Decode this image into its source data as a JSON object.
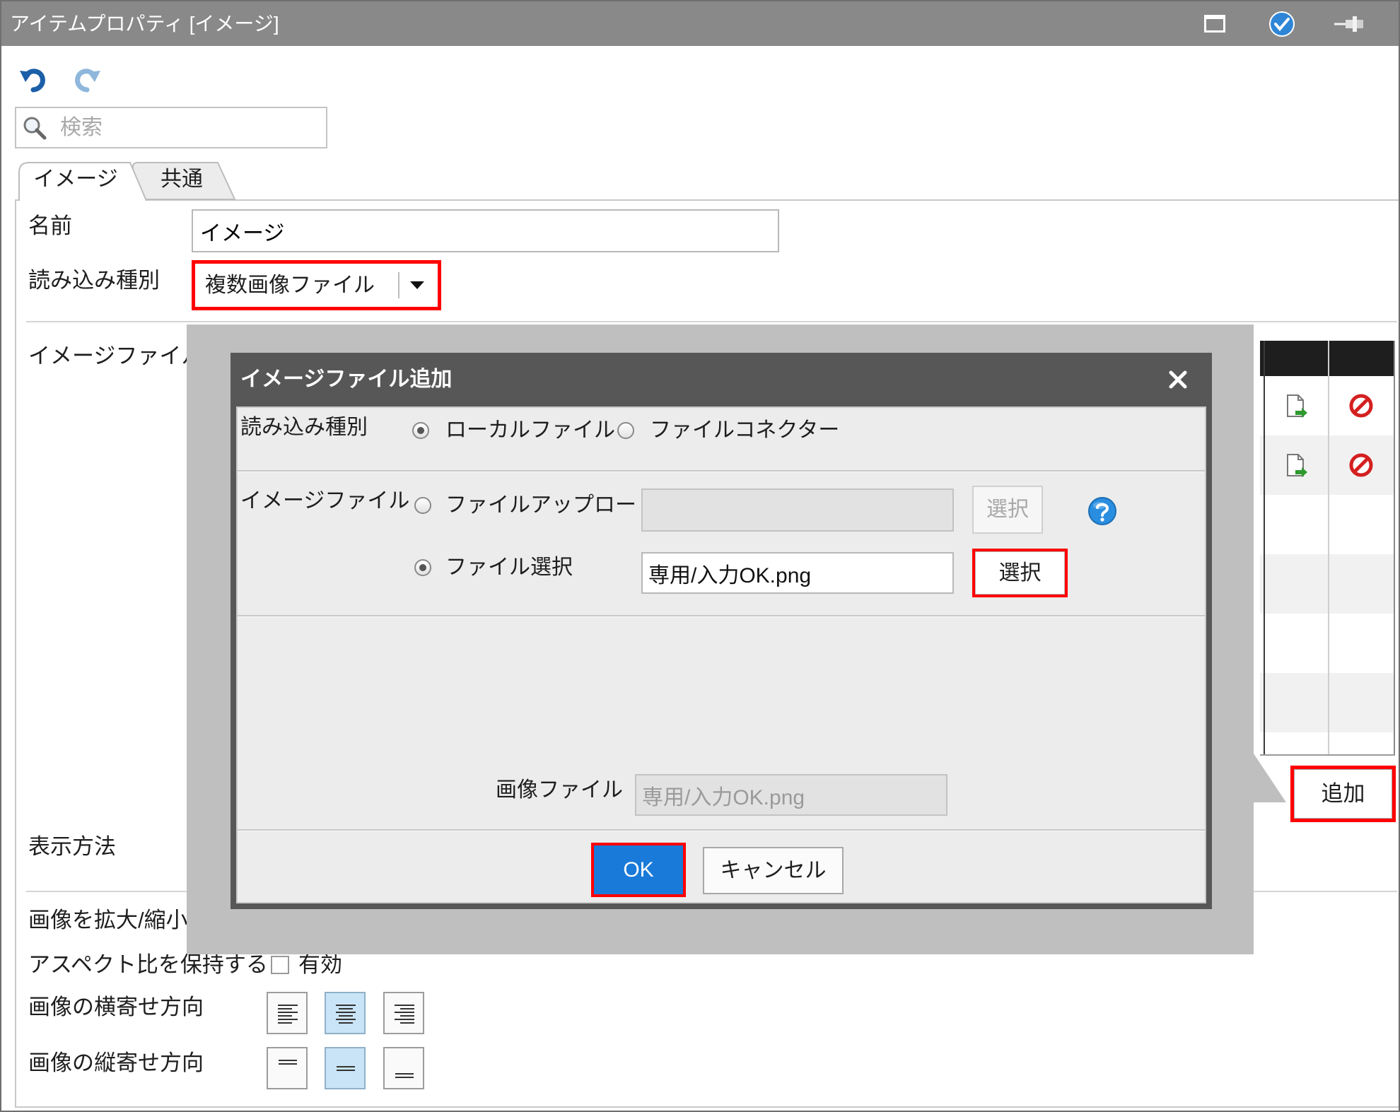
{
  "window": {
    "title": "アイテムプロパティ [イメージ]",
    "icons": [
      "maximize-icon",
      "check-icon",
      "pin-icon"
    ]
  },
  "toolbar": {
    "icons": [
      "undo-icon",
      "redo-icon"
    ]
  },
  "search": {
    "placeholder": "検索",
    "icon": "search-icon"
  },
  "tabs": [
    {
      "label": "イメージ",
      "active": true
    },
    {
      "label": "共通",
      "active": false
    }
  ],
  "form": {
    "name_label": "名前",
    "name_value": "イメージ",
    "load_type_label": "読み込み種別",
    "load_type_value": "複数画像ファイル",
    "image_file_label": "イメージファイル",
    "display_method_label": "表示方法",
    "scale_label": "画像を拡大/縮小",
    "aspect_label": "アスペクト比を保持する",
    "aspect_checkbox_label": "有効",
    "aspect_checked": false,
    "h_align_label": "画像の横寄せ方向",
    "h_align": {
      "options": [
        "align-left-icon",
        "align-center-icon",
        "align-right-icon"
      ],
      "selected": "align-center-icon"
    },
    "v_align_label": "画像の縦寄せ方向",
    "v_align": {
      "options": [
        "align-top-icon",
        "align-middle-icon",
        "align-bottom-icon"
      ],
      "selected": "align-middle-icon"
    }
  },
  "file_list": {
    "rows": [
      {
        "edit_icon": "file-edit-icon",
        "delete_icon": "delete-icon"
      },
      {
        "edit_icon": "file-edit-icon",
        "delete_icon": "delete-icon"
      }
    ],
    "add_button": "追加"
  },
  "dialog": {
    "title": "イメージファイル追加",
    "close_icon": "close-icon",
    "load_type_label": "読み込み種別",
    "load_type_options": [
      {
        "label": "ローカルファイル",
        "checked": true
      },
      {
        "label": "ファイルコネクター",
        "checked": false
      }
    ],
    "image_file_label": "イメージファイル",
    "upload_option": {
      "label": "ファイルアップロード",
      "checked": false
    },
    "upload_button": "選択",
    "help_icon": "help-icon",
    "select_option": {
      "label": "ファイル選択",
      "checked": true
    },
    "select_input_value": "専用/入力OK.png",
    "select_button": "選択",
    "image_file_field_label": "画像ファイル",
    "image_file_field_value": "専用/入力OK.png",
    "ok_button": "OK",
    "cancel_button": "キャンセル"
  },
  "colors": {
    "title_bar": "#898989",
    "highlight": "#ff0000",
    "primary_button": "#1a7ad9",
    "selected_align": "#c9e4f6",
    "dialog_frame": "#575757",
    "backdrop": "#bfbfbf"
  }
}
